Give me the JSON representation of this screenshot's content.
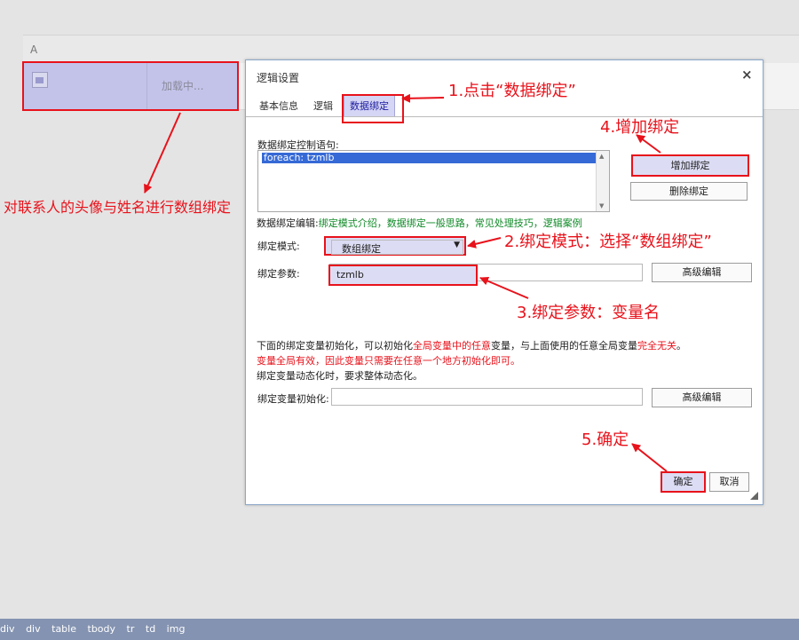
{
  "canvas": {
    "column_label": "A",
    "loading_text": "加载中..."
  },
  "dialog": {
    "title": "逻辑设置",
    "close_symbol": "×",
    "tabs": [
      "基本信息",
      "逻辑",
      "数据绑定"
    ],
    "statement_label": "数据绑定控制语句:",
    "statement_item": "foreach: tzmlb",
    "add_binding": "增加绑定",
    "delete_binding": "删除绑定",
    "edit_prefix": "数据绑定编辑:",
    "edit_links": [
      "绑定模式介绍",
      "数据绑定一般思路",
      "常见处理技巧",
      "逻辑案例"
    ],
    "edit_sep": "，",
    "mode_label": "绑定模式:",
    "mode_value": "数组绑定",
    "param_label": "绑定参数:",
    "param_value": "tzmlb",
    "advanced_edit": "高级编辑",
    "info1_a": "下面的绑定变量初始化，可以初始化",
    "info1_red1": "全局变量中的任意",
    "info1_b": "变量，与上面使用的任意全局变量",
    "info1_red2": "完全无关",
    "info1_c": "。",
    "info2": "变量全局有效，因此变量只需要在任意一个地方初始化即可。",
    "info3": "绑定变量动态化时，要求整体动态化。",
    "init_label": "绑定变量初始化:",
    "ok": "确定",
    "cancel": "取消"
  },
  "annotations": {
    "step1": "1.点击“数据绑定”",
    "step2": "2.绑定模式：选择“数组绑定”",
    "step3": "3.绑定参数：变量名",
    "step4": "4.增加绑定",
    "step5": "5.确定",
    "left_note": "对联系人的头像与姓名进行数组绑定"
  },
  "statusbar": {
    "breadcrumb": [
      "div",
      "div",
      "table",
      "tbody",
      "tr",
      "td",
      "img"
    ]
  },
  "colors": {
    "annotation_red": "#e8121b",
    "selected_blue": "#c3c3ea",
    "link_green": "#118a28",
    "statusbar": "#8493b1"
  }
}
